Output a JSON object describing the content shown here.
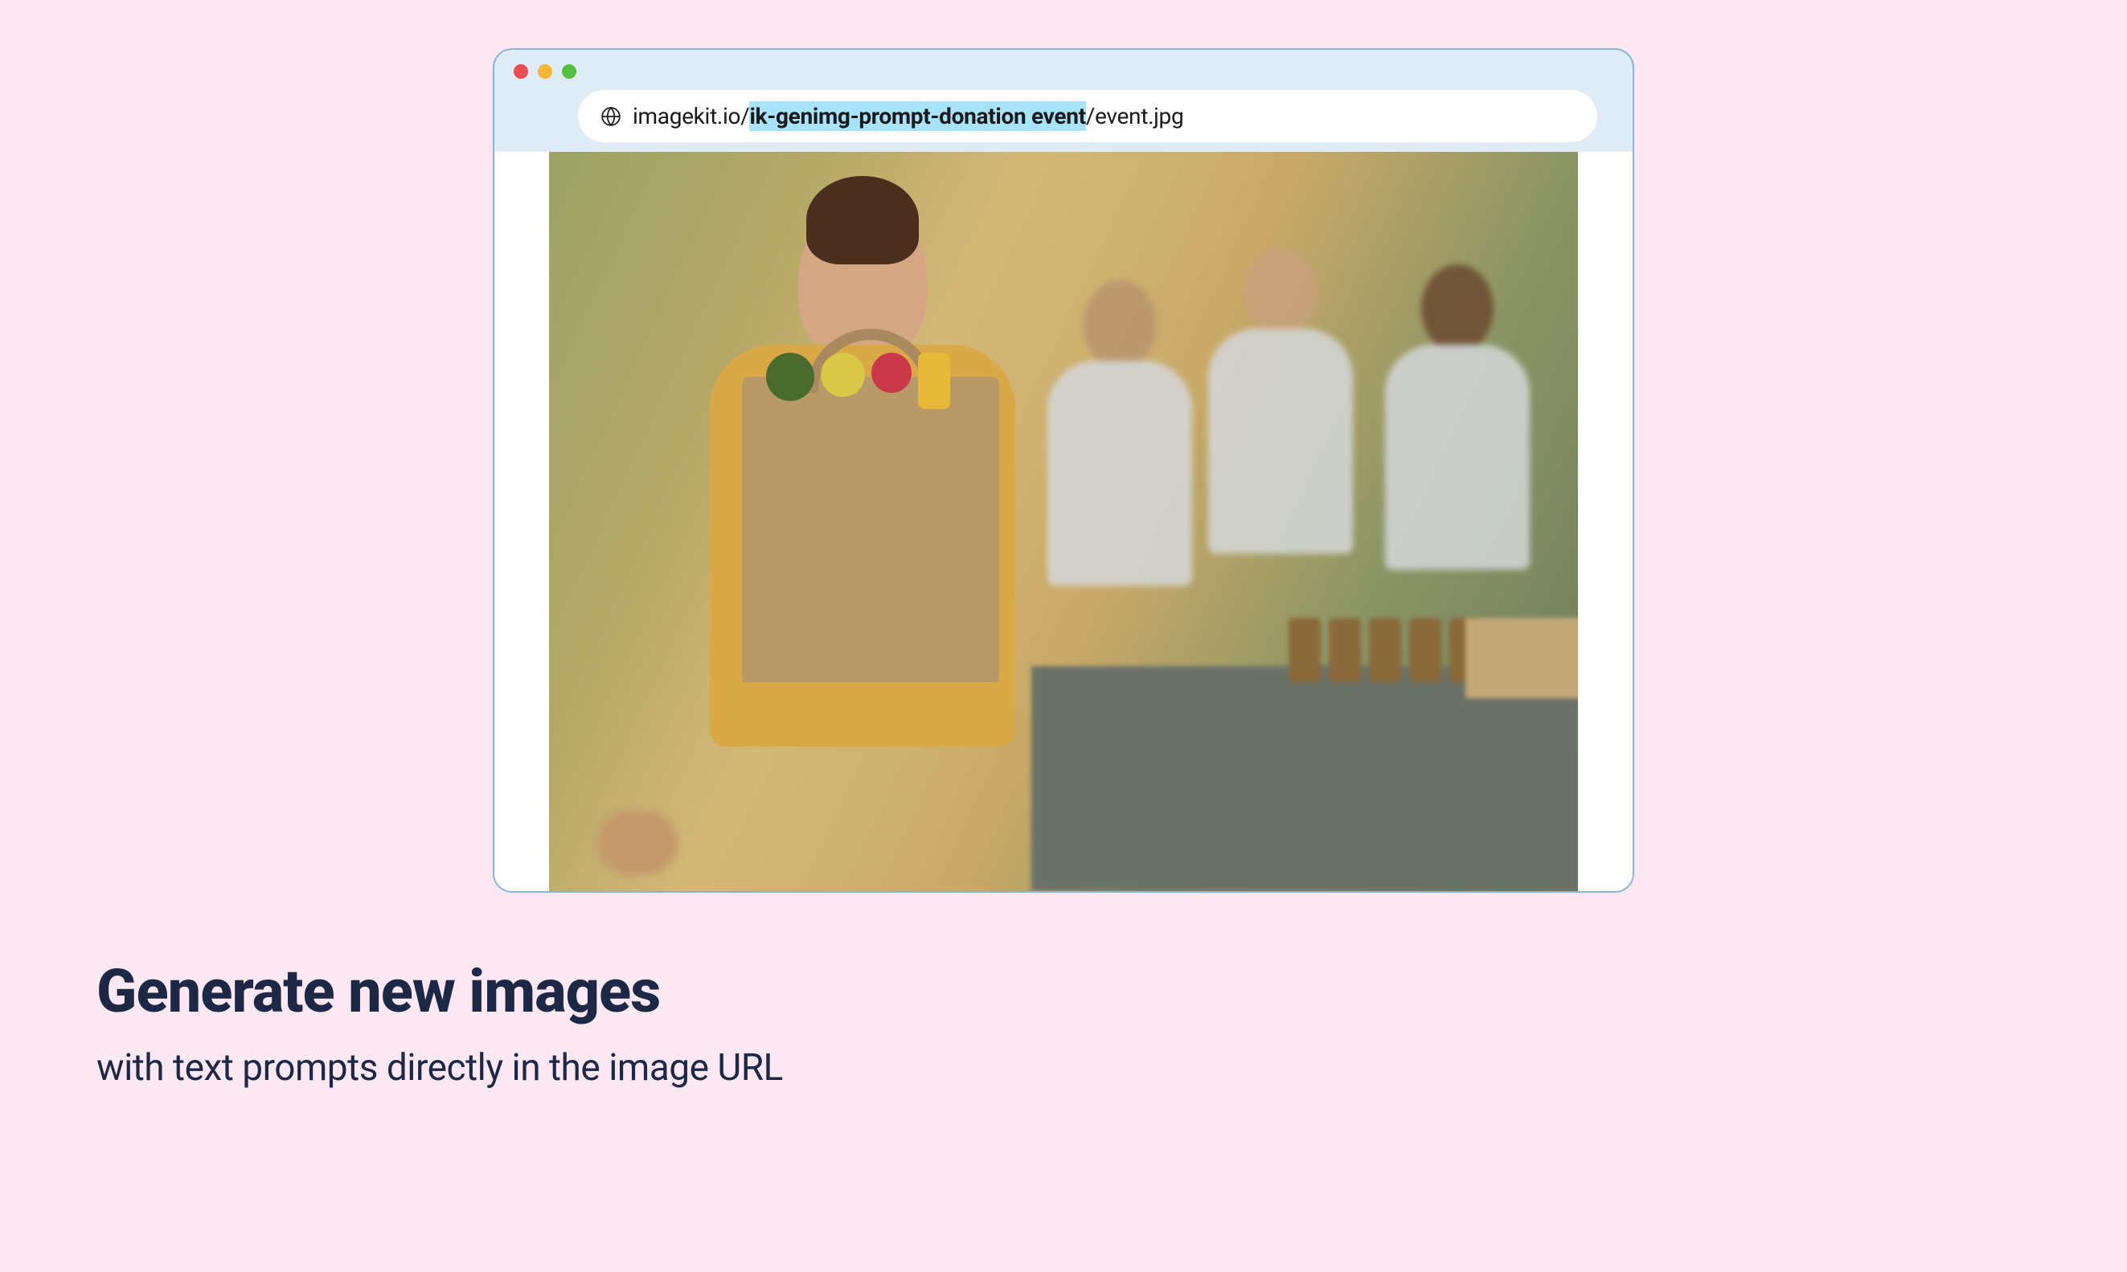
{
  "browser": {
    "url": {
      "domain": "imagekit.io/",
      "prompt_segment": "ik-genimg-prompt-donation event",
      "slash": "/",
      "filename": "event.jpg"
    }
  },
  "content": {
    "image_alt": "Generated image of a donation event showing a woman holding a grocery bag with volunteers at a table in the background"
  },
  "hero": {
    "headline": "Generate new images",
    "subheadline": "with text prompts directly in the image URL"
  }
}
